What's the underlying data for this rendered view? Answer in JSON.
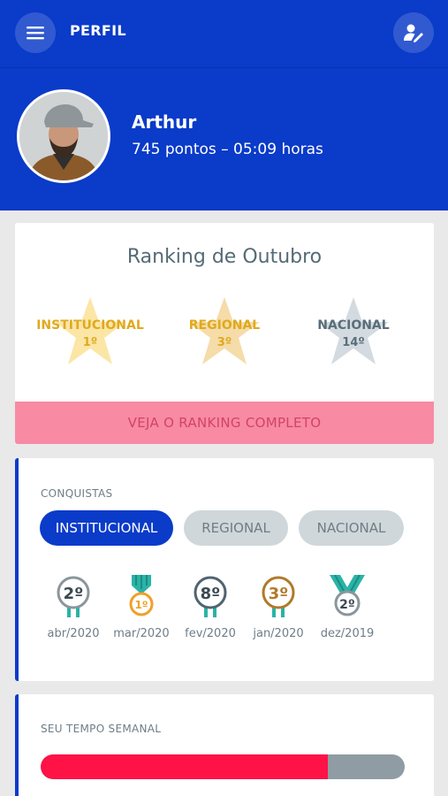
{
  "header": {
    "title": "PERFIL",
    "menu_icon": "menu-icon",
    "edit_icon": "edit-profile-icon"
  },
  "profile": {
    "name": "Arthur",
    "stats": "745 pontos – 05:09 horas"
  },
  "ranking": {
    "title": "Ranking de Outubro",
    "items": [
      {
        "label": "INSTITUCIONAL",
        "position": "1º",
        "color": "#e0a91e"
      },
      {
        "label": "REGIONAL",
        "position": "3º",
        "color": "#e0a91e"
      },
      {
        "label": "NACIONAL",
        "position": "14º",
        "color": "#5a6e7a"
      }
    ],
    "button": "VEJA O RANKING COMPLETO"
  },
  "conquistas": {
    "label": "CONQUISTAS",
    "tabs": [
      "INSTITUCIONAL",
      "REGIONAL",
      "NACIONAL"
    ],
    "medals": [
      {
        "rank": "2º",
        "date": "abr/2020"
      },
      {
        "rank": "1º",
        "date": "mar/2020"
      },
      {
        "rank": "8º",
        "date": "fev/2020"
      },
      {
        "rank": "3º",
        "date": "jan/2020"
      },
      {
        "rank": "2º",
        "date": "dez/2019"
      }
    ]
  },
  "tempo": {
    "label": "SEU TEMPO SEMANAL",
    "progress": 0.79
  },
  "colors": {
    "primary": "#0a3bc9",
    "accent": "#ff1246",
    "gold": "#e0a91e",
    "slate": "#5a6e7a"
  }
}
